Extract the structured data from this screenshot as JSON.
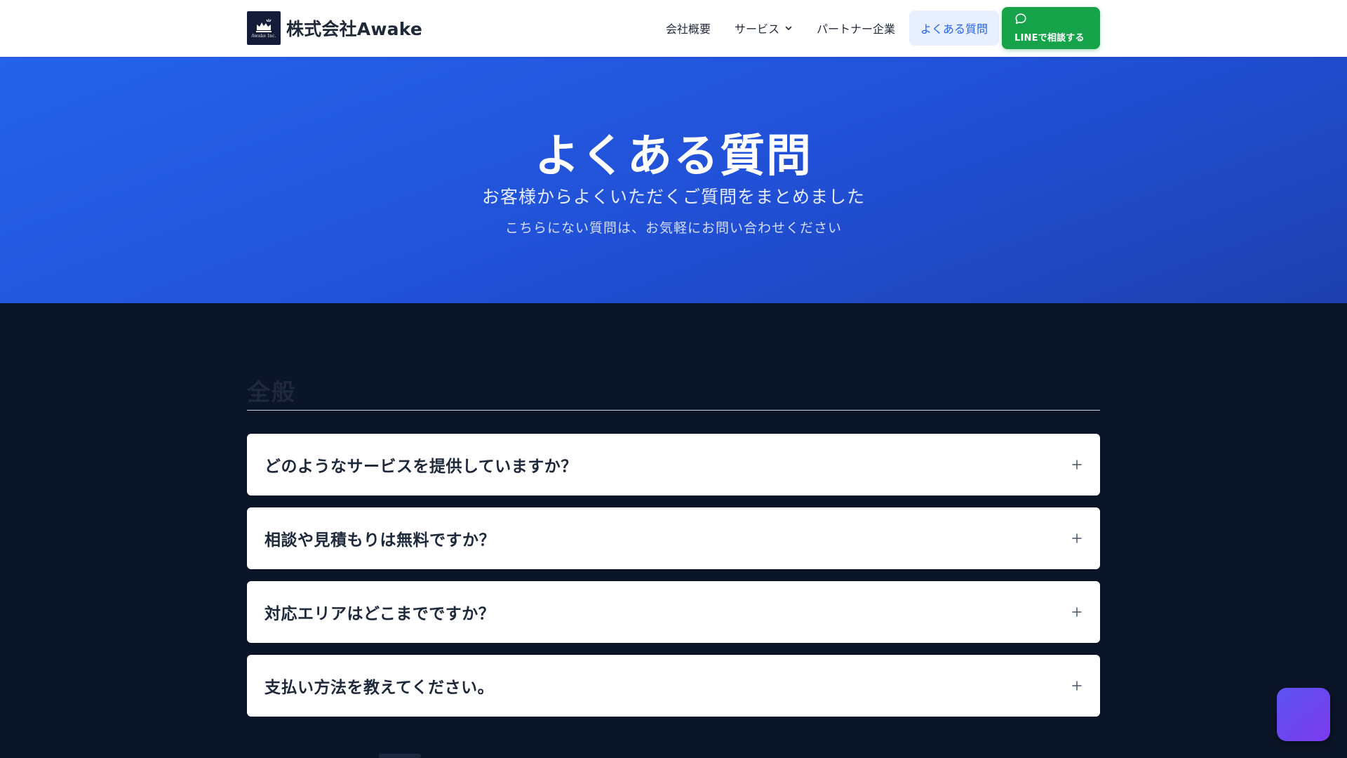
{
  "header": {
    "logo_text": "Awake Inc.",
    "brand_name": "株式会社Awake",
    "nav": {
      "company": "会社概要",
      "services": "サービス",
      "partners": "パートナー企業",
      "faq": "よくある質問",
      "line_button": "LINEで相談する"
    },
    "icons": {
      "services_dropdown": "chevron-down-icon",
      "line_button": "chat-bubble-icon"
    }
  },
  "hero": {
    "title": "よくある質問",
    "subtitle": "お客様からよくいただくご質問をまとめました",
    "note": "こちらにない質問は、お気軽にお問い合わせください"
  },
  "faq": {
    "category": "全般",
    "items": [
      {
        "question": "どのようなサービスを提供していますか？"
      },
      {
        "question": "相談や見積もりは無料ですか？"
      },
      {
        "question": "対応エリアはどこまでですか？"
      },
      {
        "question": "支払い方法を教えてください。"
      }
    ],
    "expand_icon": "plus-icon"
  },
  "colors": {
    "hero_start": "#2563eb",
    "hero_end": "#1e40af",
    "line_green": "#16a34a",
    "page_dark": "#0b1528",
    "active_nav_bg": "#e8efff",
    "chat_button": "#6d4aef"
  }
}
